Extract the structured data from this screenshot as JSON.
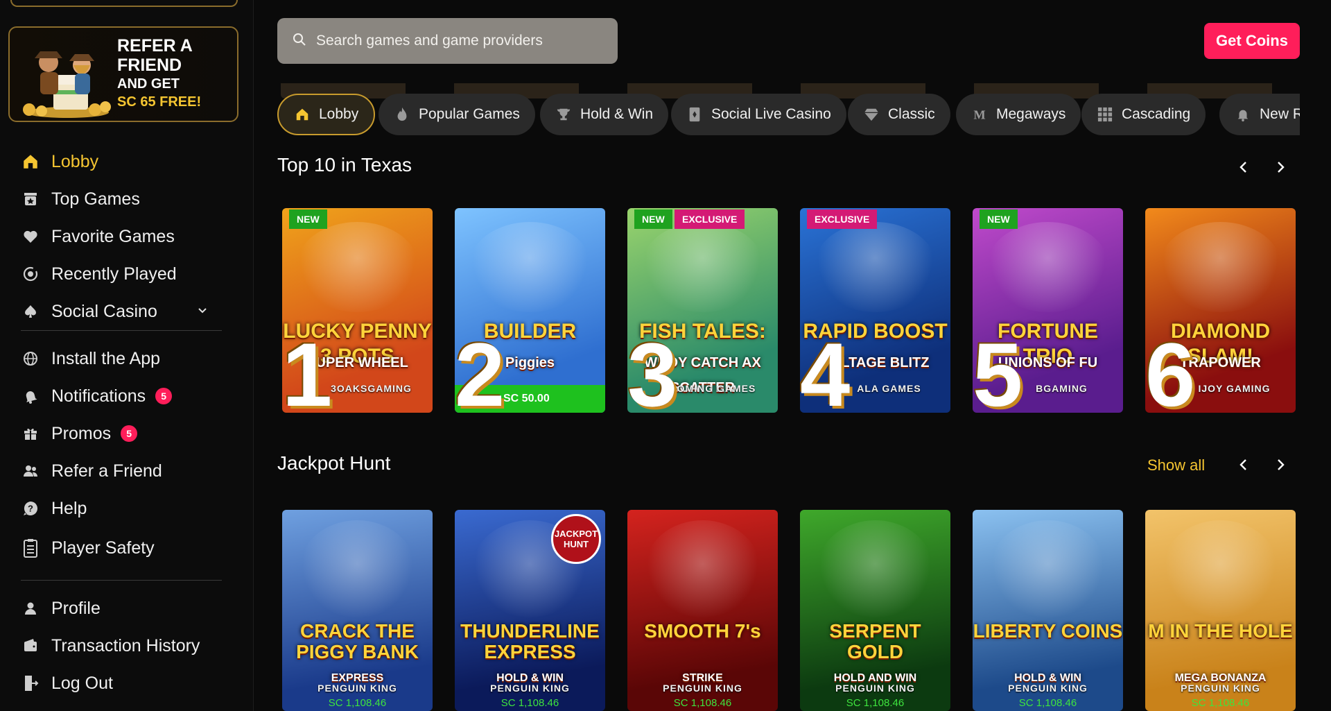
{
  "sidebar": {
    "refer_banner": {
      "line1": "REFER A",
      "line2": "FRIEND",
      "line3": "AND GET",
      "line4": "SC 65 FREE!"
    },
    "items": [
      {
        "label": "Lobby",
        "icon": "home-icon",
        "active": true
      },
      {
        "label": "Top Games",
        "icon": "top-games-icon"
      },
      {
        "label": "Favorite Games",
        "icon": "heart-icon"
      },
      {
        "label": "Recently Played",
        "icon": "recent-icon"
      },
      {
        "label": "Social Casino",
        "icon": "spade-icon"
      },
      {
        "label": "Install the App",
        "icon": "globe-icon"
      },
      {
        "label": "Notifications",
        "icon": "bell-icon",
        "badge": "5"
      },
      {
        "label": "Promos",
        "icon": "gift-icon",
        "badge": "5"
      },
      {
        "label": "Refer a Friend",
        "icon": "users-icon"
      },
      {
        "label": "Help",
        "icon": "help-icon"
      },
      {
        "label": "Player Safety",
        "icon": "clipboard-icon"
      },
      {
        "label": "Profile",
        "icon": "user-icon"
      },
      {
        "label": "Transaction History",
        "icon": "wallet-icon"
      },
      {
        "label": "Log Out",
        "icon": "logout-icon"
      }
    ]
  },
  "header": {
    "search_placeholder": "Search games and game providers",
    "get_coins": "Get Coins"
  },
  "categories": [
    {
      "label": "Lobby",
      "icon": "home-icon",
      "active": true
    },
    {
      "label": "Popular Games",
      "icon": "flame-icon"
    },
    {
      "label": "Hold & Win",
      "icon": "trophy-icon"
    },
    {
      "label": "Social Live Casino",
      "icon": "card-icon"
    },
    {
      "label": "Classic",
      "icon": "diamond-icon"
    },
    {
      "label": "Megaways",
      "icon": "m-icon"
    },
    {
      "label": "Cascading",
      "icon": "grid-icon"
    },
    {
      "label": "New Re",
      "icon": "bell-icon"
    }
  ],
  "top10": {
    "title": "Top 10 in Texas",
    "games": [
      {
        "rank": "1",
        "title": "LUCKY PENNY 3 POTS",
        "subtitle": "SUPER WHEEL",
        "provider": "3OAKSGAMING",
        "tags": [
          "NEW"
        ],
        "bg1": "#d2471a",
        "bg2": "#f0a31b"
      },
      {
        "rank": "2",
        "title": "BUILDER",
        "subtitle": "Piggies",
        "provider": "",
        "tags": [],
        "price": "SC 50.00",
        "bg1": "#2f6fd0",
        "bg2": "#7ec3ff"
      },
      {
        "rank": "3",
        "title": "FISH TALES:",
        "subtitle": "WBOY CATCH AX SCATTER",
        "provider": "OMING GAMES",
        "tags": [
          "NEW",
          "EXCLUSIVE"
        ],
        "bg1": "#2a8a6a",
        "bg2": "#9ad46c"
      },
      {
        "rank": "4",
        "title": "RAPID BOOST",
        "subtitle": "VOLTAGE BLITZ",
        "provider": "ALA GAMES",
        "tags": [
          "EXCLUSIVE"
        ],
        "bg1": "#0e2f7a",
        "bg2": "#2a73d6"
      },
      {
        "rank": "5",
        "title": "FORTUNE TRIO",
        "subtitle": "UNIONS OF FU",
        "provider": "BGAMING",
        "tags": [
          "NEW"
        ],
        "bg1": "#5a1d8e",
        "bg2": "#c04acb"
      },
      {
        "rank": "6",
        "title": "DIAMOND SLAM!",
        "subtitle": "TRAPOWER",
        "provider": "IJOY GAMING",
        "tags": [],
        "bg1": "#8a0e0e",
        "bg2": "#f28a1b"
      }
    ]
  },
  "jackpot": {
    "title": "Jackpot Hunt",
    "show_all": "Show all",
    "games": [
      {
        "title": "CRACK THE PIGGY BANK",
        "subtitle": "EXPRESS",
        "provider": "PENGUIN KING",
        "price": "SC 1,108.46",
        "bg1": "#1a3a8a",
        "bg2": "#6fa0e0"
      },
      {
        "title": "THUNDERLINE EXPRESS",
        "subtitle": "HOLD & WIN",
        "provider": "PENGUIN KING",
        "price": "SC 1,108.46",
        "bg1": "#0b1a5a",
        "bg2": "#3a6ad0",
        "badge": "JACKPOT HUNT"
      },
      {
        "title": "SMOOTH 7's",
        "subtitle": "STRIKE",
        "provider": "PENGUIN KING",
        "price": "SC 1,108.46",
        "bg1": "#5a0606",
        "bg2": "#d4231e"
      },
      {
        "title": "SERPENT GOLD",
        "subtitle": "HOLD AND WIN",
        "provider": "PENGUIN KING",
        "price": "SC 1,108.46",
        "bg1": "#0c3a10",
        "bg2": "#3fa82b"
      },
      {
        "title": "LIBERTY COINS",
        "subtitle": "HOLD & WIN",
        "provider": "PENGUIN KING",
        "price": "SC 1,108.46",
        "bg1": "#1d4a8a",
        "bg2": "#8bc1f0"
      },
      {
        "title": "M IN THE HOLE",
        "subtitle": "MEGA BONANZA",
        "provider": "PENGUIN KING",
        "price": "SC 1,108.46",
        "bg1": "#c9821a",
        "bg2": "#f2c36a"
      }
    ]
  },
  "colors": {
    "accent": "#f5c531",
    "cta": "#ff1e5a",
    "new_tag": "#1fa21f",
    "exclusive_tag": "#d41a75"
  }
}
